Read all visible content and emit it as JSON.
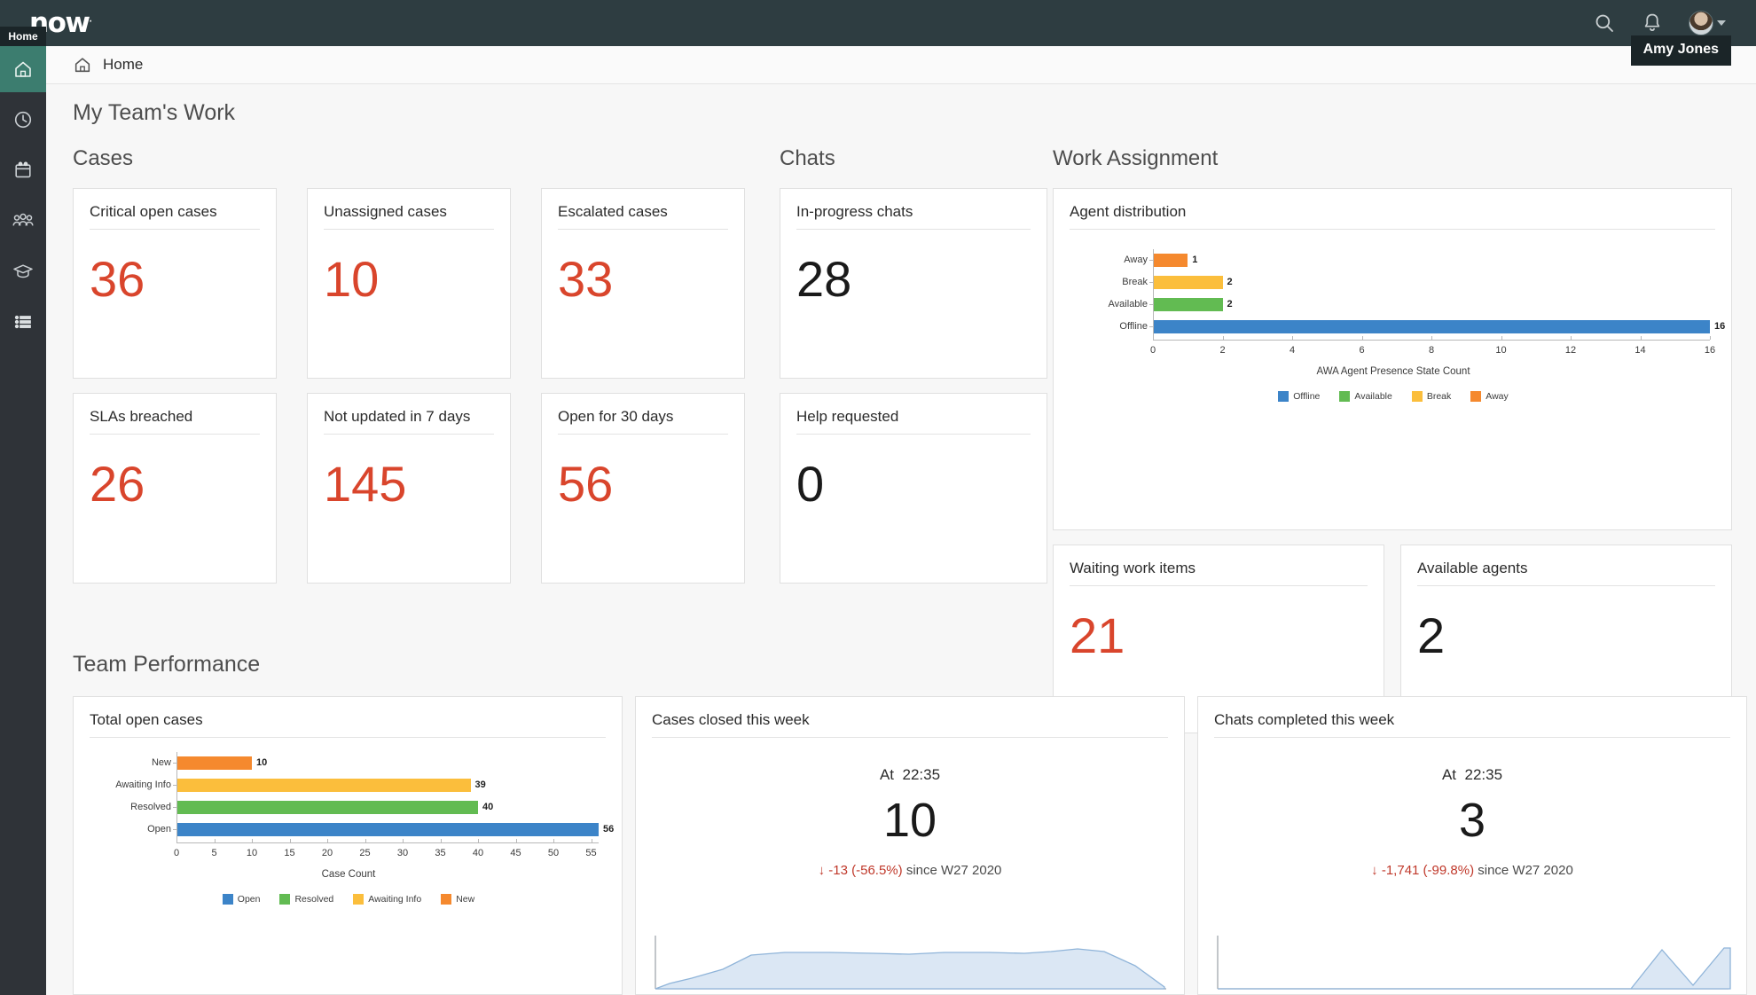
{
  "topbar": {
    "logo": "now",
    "logo_mark": ".",
    "search_icon": "search-icon",
    "bell_icon": "notification-bell-icon",
    "avatar_icon": "avatar",
    "user_tooltip": "Amy Jones"
  },
  "rail": {
    "home_tooltip": "Home",
    "items": [
      {
        "icon": "home-icon",
        "label": "Home",
        "active": true
      },
      {
        "icon": "clock-icon",
        "label": "History",
        "active": false
      },
      {
        "icon": "calendar-icon",
        "label": "Calendar",
        "active": false
      },
      {
        "icon": "people-icon",
        "label": "Teams",
        "active": false
      },
      {
        "icon": "graduation-cap-icon",
        "label": "Learning",
        "active": false
      },
      {
        "icon": "list-icon",
        "label": "Lists",
        "active": false
      }
    ]
  },
  "breadcrumb": {
    "icon": "home-icon",
    "label": "Home"
  },
  "page": {
    "title": "My Team's Work",
    "performance_title": "Team Performance"
  },
  "groups": {
    "cases": "Cases",
    "chats": "Chats",
    "work_assignment": "Work Assignment"
  },
  "cases_cards": [
    {
      "title": "Critical open cases",
      "value": "36",
      "tone": "red"
    },
    {
      "title": "Unassigned cases",
      "value": "10",
      "tone": "red"
    },
    {
      "title": "Escalated cases",
      "value": "33",
      "tone": "red"
    },
    {
      "title": "SLAs breached",
      "value": "26",
      "tone": "red"
    },
    {
      "title": "Not updated in 7 days",
      "value": "145",
      "tone": "red"
    },
    {
      "title": "Open for 30 days",
      "value": "56",
      "tone": "red"
    }
  ],
  "chats_cards": [
    {
      "title": "In-progress chats",
      "value": "28",
      "tone": "dark"
    },
    {
      "title": "Help requested",
      "value": "0",
      "tone": "dark"
    }
  ],
  "work_cards": [
    {
      "title": "Waiting work items",
      "value": "21",
      "tone": "red"
    },
    {
      "title": "Available agents",
      "value": "2",
      "tone": "dark"
    }
  ],
  "agent_distribution": {
    "title": "Agent distribution"
  },
  "total_open_cases": {
    "title": "Total open cases"
  },
  "cases_closed": {
    "title": "Cases closed this week",
    "at_label": "At",
    "at_time": "22:35",
    "value": "10",
    "delta_arrow": "↓",
    "delta_value": "-13 (-56.5%)",
    "delta_suffix": "since W27 2020"
  },
  "chats_completed": {
    "title": "Chats completed this week",
    "at_label": "At",
    "at_time": "22:35",
    "value": "3",
    "delta_arrow": "↓",
    "delta_value": "-1,741 (-99.8%)",
    "delta_suffix": "since W27 2020"
  },
  "colors": {
    "blue": "#3c84c8",
    "green": "#62bb52",
    "yellow": "#fbbe3c",
    "orange": "#f5892e",
    "red": "#d9452c",
    "nav_dark": "#2e3d41",
    "rail_dark": "#2f3338",
    "accent_green": "#3c7d6f",
    "spark_fill": "#dbe7f4",
    "spark_line": "#8fb4d9"
  },
  "chart_data": [
    {
      "type": "bar",
      "orientation": "horizontal",
      "title": "Agent distribution",
      "categories": [
        "Offline",
        "Available",
        "Break",
        "Away"
      ],
      "values": [
        16,
        2,
        2,
        1
      ],
      "bar_colors": [
        "#3c84c8",
        "#62bb52",
        "#fbbe3c",
        "#f5892e"
      ],
      "data_labels": [
        "16",
        "2",
        "2",
        "1"
      ],
      "xlabel": "AWA Agent Presence State Count",
      "ylabel": "",
      "xlim": [
        0,
        16
      ],
      "xticks": [
        0,
        2,
        4,
        6,
        8,
        10,
        12,
        14,
        16
      ],
      "grid": false,
      "legend": [
        "Offline",
        "Available",
        "Break",
        "Away"
      ],
      "legend_position": "bottom"
    },
    {
      "type": "bar",
      "orientation": "horizontal",
      "title": "Total open cases",
      "categories": [
        "Open",
        "Resolved",
        "Awaiting Info",
        "New"
      ],
      "values": [
        56,
        40,
        39,
        10
      ],
      "bar_colors": [
        "#3c84c8",
        "#62bb52",
        "#fbbe3c",
        "#f5892e"
      ],
      "data_labels": [
        "56",
        "40",
        "39",
        "10"
      ],
      "xlabel": "Case Count",
      "ylabel": "",
      "xlim": [
        0,
        56
      ],
      "xticks": [
        0,
        5,
        10,
        15,
        20,
        25,
        30,
        35,
        40,
        45,
        50,
        55
      ],
      "grid": false,
      "legend": [
        "Open",
        "Resolved",
        "Awaiting Info",
        "New"
      ],
      "legend_position": "bottom"
    },
    {
      "type": "area",
      "title": "Cases closed this week",
      "x": [
        0,
        1,
        2,
        3,
        4,
        5,
        6,
        7,
        8,
        9,
        10,
        11,
        12,
        13,
        14,
        15,
        16
      ],
      "values": [
        0,
        2,
        4,
        7,
        10,
        11,
        11,
        11,
        10,
        11,
        11,
        11,
        11,
        12,
        11,
        7,
        0
      ],
      "ylim": [
        0,
        13
      ],
      "grid": false,
      "annotation": "↓ -13 (-56.5%) since W27 2020"
    },
    {
      "type": "area",
      "title": "Chats completed this week",
      "x": [
        0,
        1,
        2,
        3,
        4,
        5,
        6,
        7,
        8,
        9,
        10,
        11,
        12,
        13,
        14
      ],
      "values": [
        0,
        0,
        0,
        0,
        0,
        0,
        0,
        0,
        0,
        0,
        0,
        5,
        1,
        3,
        6
      ],
      "ylim": [
        0,
        6
      ],
      "grid": false,
      "annotation": "↓ -1,741 (-99.8%) since W27 2020"
    }
  ]
}
